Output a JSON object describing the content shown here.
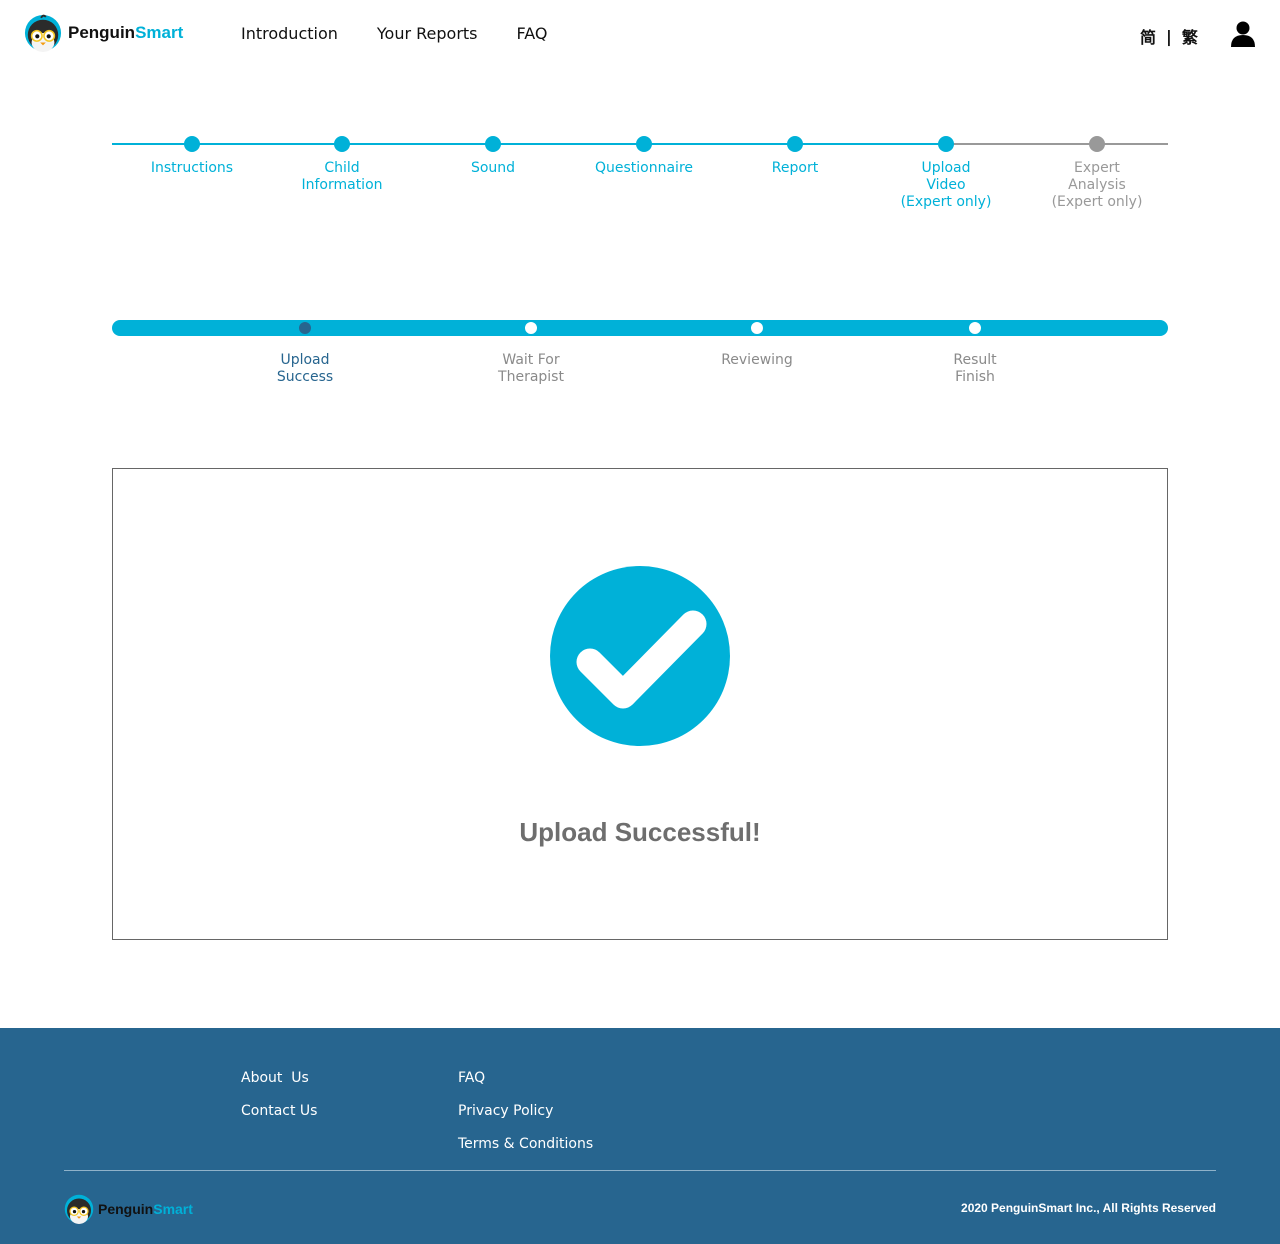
{
  "brand": {
    "name_part1": "Penguin",
    "name_part2": "Smart"
  },
  "nav": [
    "Introduction",
    "Your Reports",
    "FAQ"
  ],
  "lang": {
    "simplified": "简",
    "separator": "|",
    "traditional": "繁"
  },
  "steps": [
    {
      "label": "Instructions",
      "done": true
    },
    {
      "label": "Child\nInformation",
      "done": true
    },
    {
      "label": "Sound",
      "done": true
    },
    {
      "label": "Questionnaire",
      "done": true
    },
    {
      "label": "Report",
      "done": true
    },
    {
      "label": "Upload\nVideo\n(Expert only)",
      "done": true
    },
    {
      "label": "Expert\nAnalysis\n(Expert only)",
      "done": false
    }
  ],
  "progress_steps": [
    {
      "label": "Upload\nSuccess",
      "state": "current"
    },
    {
      "label": "Wait For\nTherapist",
      "state": "pending"
    },
    {
      "label": "Reviewing",
      "state": "pending"
    },
    {
      "label": "Result\nFinish",
      "state": "pending"
    }
  ],
  "result": {
    "message": "Upload Successful!",
    "icon": "check-circle-icon"
  },
  "footer": {
    "col1": [
      "About  Us",
      "Contact Us"
    ],
    "col2": [
      "FAQ",
      "Privacy Policy",
      "Terms & Conditions"
    ],
    "copyright": "2020 PenguinSmart Inc., All Rights Reserved"
  },
  "colors": {
    "accent": "#00b1d8",
    "inactive": "#999999",
    "current": "#27658f",
    "footer_bg": "#27658f",
    "result_text": "#6e6e6e"
  }
}
